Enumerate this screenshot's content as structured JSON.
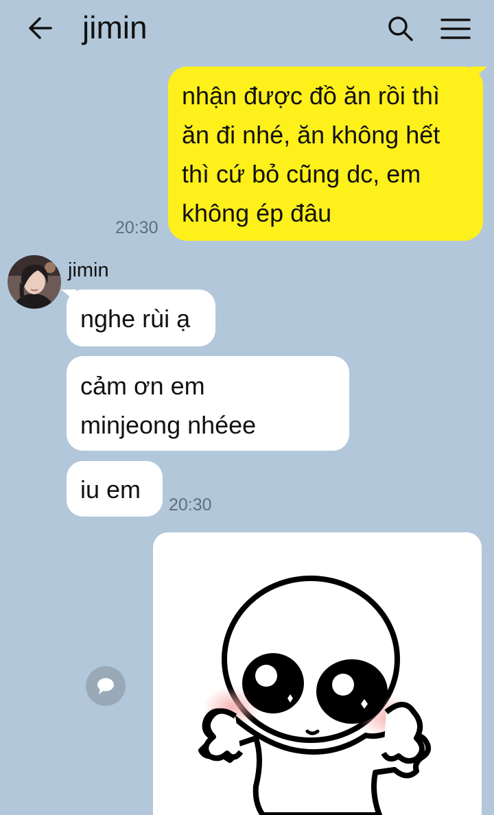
{
  "header": {
    "title": "jimin",
    "back_icon": "arrow-left-icon",
    "search_icon": "search-icon",
    "menu_icon": "hamburger-menu-icon"
  },
  "messages": [
    {
      "direction": "outgoing",
      "lines": [
        "nhận được đồ ăn rồi thì",
        "ăn đi nhé, ăn không hết",
        "thì cứ bỏ cũng dc, em",
        "không ép đâu"
      ],
      "time": "20:30"
    },
    {
      "direction": "incoming",
      "sender": "jimin",
      "lines": [
        "nghe rùi ạ"
      ]
    },
    {
      "direction": "incoming",
      "lines": [
        "cảm ơn em",
        "minjeong nhéee"
      ]
    },
    {
      "direction": "incoming",
      "lines": [
        "iu em"
      ],
      "time": "20:30"
    },
    {
      "direction": "outgoing",
      "type": "sticker",
      "sticker_icon": "blushing-creature-sticker"
    }
  ],
  "colors": {
    "background": "#b2c7da",
    "outgoing_bubble": "#fef01b",
    "incoming_bubble": "#ffffff"
  }
}
